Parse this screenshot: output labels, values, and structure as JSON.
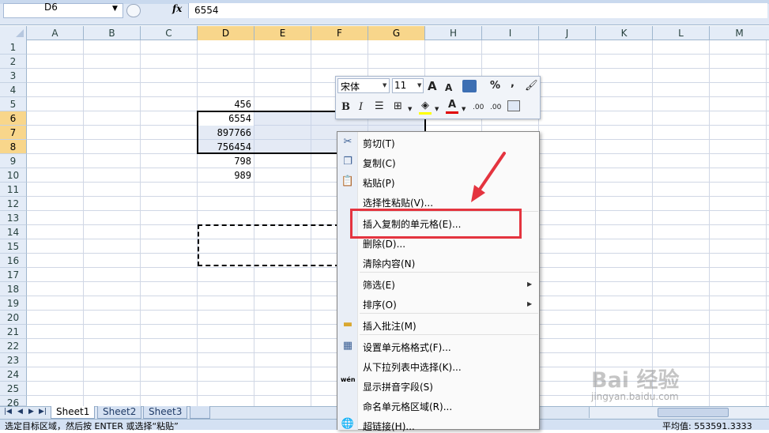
{
  "formula_bar": {
    "name_box": "D6",
    "fx_label": "fx",
    "value": "6554"
  },
  "columns": [
    "A",
    "B",
    "C",
    "D",
    "E",
    "F",
    "G",
    "H",
    "I",
    "J",
    "K",
    "L",
    "M"
  ],
  "rows": [
    "1",
    "2",
    "3",
    "4",
    "5",
    "6",
    "7",
    "8",
    "9",
    "10",
    "11",
    "12",
    "13",
    "14",
    "15",
    "16",
    "17",
    "18",
    "19",
    "20",
    "21",
    "22",
    "23",
    "24",
    "25",
    "26"
  ],
  "cells": {
    "D5": "456",
    "D6": "6554",
    "D7": "897766",
    "D8": "756454",
    "D9": "798",
    "D10": "989"
  },
  "mini_toolbar": {
    "font_name": "宋体",
    "font_size": "11",
    "grow_font": "A",
    "shrink_font": "A",
    "percent": "%",
    "comma": ",",
    "bold": "B",
    "italic": "I",
    "font_color": "A",
    "inc_decimal": ".00",
    "dec_decimal": ".00"
  },
  "context_menu": {
    "items": [
      {
        "label": "剪切(T)"
      },
      {
        "label": "复制(C)"
      },
      {
        "label": "粘贴(P)"
      },
      {
        "label": "选择性粘贴(V)..."
      },
      {
        "label": "插入复制的单元格(E)..."
      },
      {
        "label": "删除(D)..."
      },
      {
        "label": "清除内容(N)"
      },
      {
        "label": "筛选(E)"
      },
      {
        "label": "排序(O)"
      },
      {
        "label": "插入批注(M)"
      },
      {
        "label": "设置单元格格式(F)..."
      },
      {
        "label": "从下拉列表中选择(K)..."
      },
      {
        "label": "显示拼音字段(S)"
      },
      {
        "label": "命名单元格区域(R)..."
      },
      {
        "label": "超链接(H)..."
      }
    ],
    "pinyin_icon_text": "wén"
  },
  "sheet_tabs": [
    "Sheet1",
    "Sheet2",
    "Sheet3"
  ],
  "status_bar": {
    "message": "选定目标区域，然后按 ENTER 或选择“粘贴”",
    "average": "平均值: 553591.3333"
  },
  "watermark": {
    "text": "Bai 经验",
    "url": "jingyan.baidu.com"
  },
  "colors": {
    "highlight_box": "#e4343f",
    "selected_header": "#f8d68b",
    "header_bg": "#e4ecf7"
  }
}
